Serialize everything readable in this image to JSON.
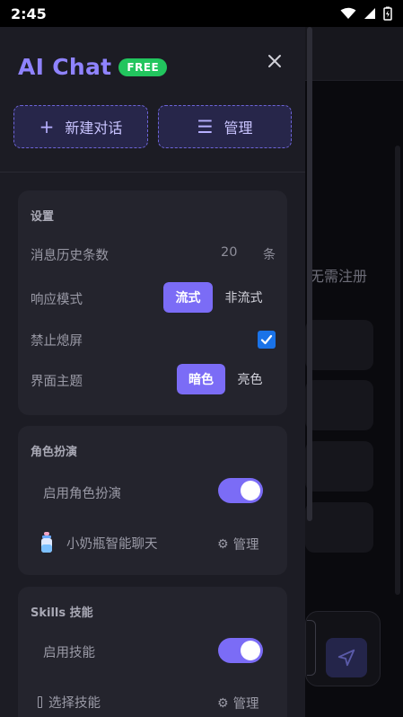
{
  "status_bar": {
    "time": "2:45"
  },
  "background": {
    "hint_text": "无需注册"
  },
  "drawer": {
    "title": "AI Chat",
    "badge": "FREE",
    "close_icon": "close-icon",
    "new_chat_label": "新建对话",
    "manage_label": "管理"
  },
  "settings": {
    "title": "设置",
    "history_label": "消息历史条数",
    "history_value": "20",
    "history_unit": "条",
    "response_label": "响应模式",
    "response_options": [
      "流式",
      "非流式"
    ],
    "response_selected": "流式",
    "no_flood_label": "禁止熄屏",
    "no_flood_checked": true,
    "theme_label": "界面主题",
    "theme_options": [
      "暗色",
      "亮色"
    ],
    "theme_selected": "暗色"
  },
  "roleplay": {
    "title": "角色扮演",
    "enable_label": "启用角色扮演",
    "enabled": true,
    "character_icon": "baby-bottle-icon",
    "character_name": "小奶瓶智能聊天",
    "manage_label": "管理"
  },
  "skills": {
    "title": "Skills 技能",
    "enable_label": "启用技能",
    "enabled": true,
    "select_label": "选择技能",
    "manage_label": "管理"
  },
  "colors": {
    "accent": "#7b6cf6",
    "title": "#8f83ff",
    "badge": "#22c55e",
    "checkbox": "#1a73e8"
  }
}
